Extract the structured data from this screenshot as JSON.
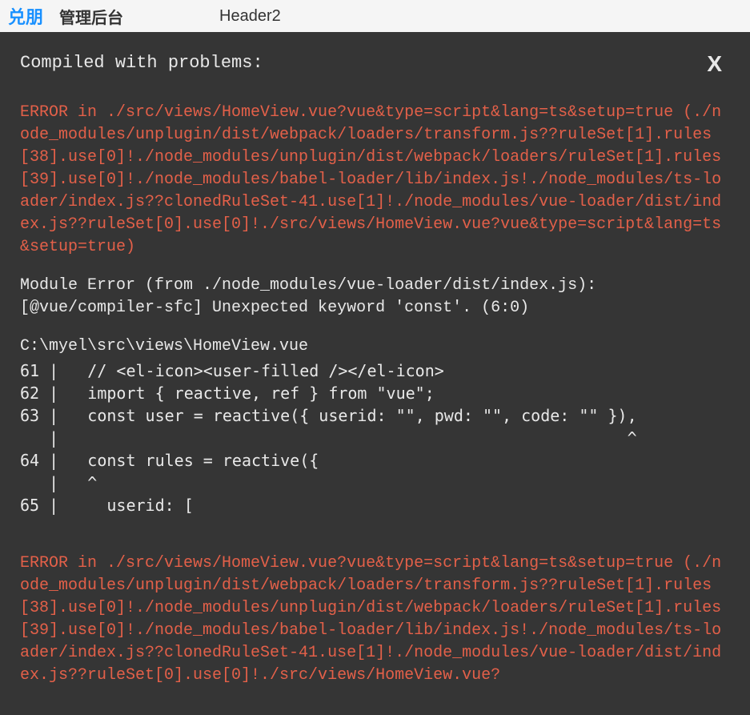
{
  "bgHeader": {
    "logo": "兑朋",
    "logoCn": "管理后台",
    "header2": "Header2"
  },
  "overlay": {
    "title": "Compiled with problems:",
    "closeLabel": "X",
    "error1": "ERROR in ./src/views/HomeView.vue?vue&type=script&lang=ts&setup=true (./node_modules/unplugin/dist/webpack/loaders/transform.js??ruleSet[1].rules[38].use[0]!./node_modules/unplugin/dist/webpack/loaders/ruleSet[1].rules[39].use[0]!./node_modules/babel-loader/lib/index.js!./node_modules/ts-loader/index.js??clonedRuleSet-41.use[1]!./node_modules/vue-loader/dist/index.js??ruleSet[0].use[0]!./src/views/HomeView.vue?vue&type=script&lang=ts&setup=true)",
    "moduleErrorLine1": "Module Error (from ./node_modules/vue-loader/dist/index.js):",
    "moduleErrorLine2": "[@vue/compiler-sfc] Unexpected keyword 'const'. (6:0)",
    "filePath": "C:\\myel\\src\\views\\HomeView.vue",
    "codeLines": "61 |   // <el-icon><user-filled /></el-icon>\n62 |   import { reactive, ref } from \"vue\";\n63 |   const user = reactive({ userid: \"\", pwd: \"\", code: \"\" }),\n   |                                                           ^\n64 |   const rules = reactive({\n   |   ^\n65 |     userid: [",
    "error2": "ERROR in ./src/views/HomeView.vue?vue&type=script&lang=ts&setup=true (./node_modules/unplugin/dist/webpack/loaders/transform.js??ruleSet[1].rules[38].use[0]!./node_modules/unplugin/dist/webpack/loaders/ruleSet[1].rules[39].use[0]!./node_modules/babel-loader/lib/index.js!./node_modules/ts-loader/index.js??clonedRuleSet-41.use[1]!./node_modules/vue-loader/dist/index.js??ruleSet[0].use[0]!./src/views/HomeView.vue?"
  }
}
